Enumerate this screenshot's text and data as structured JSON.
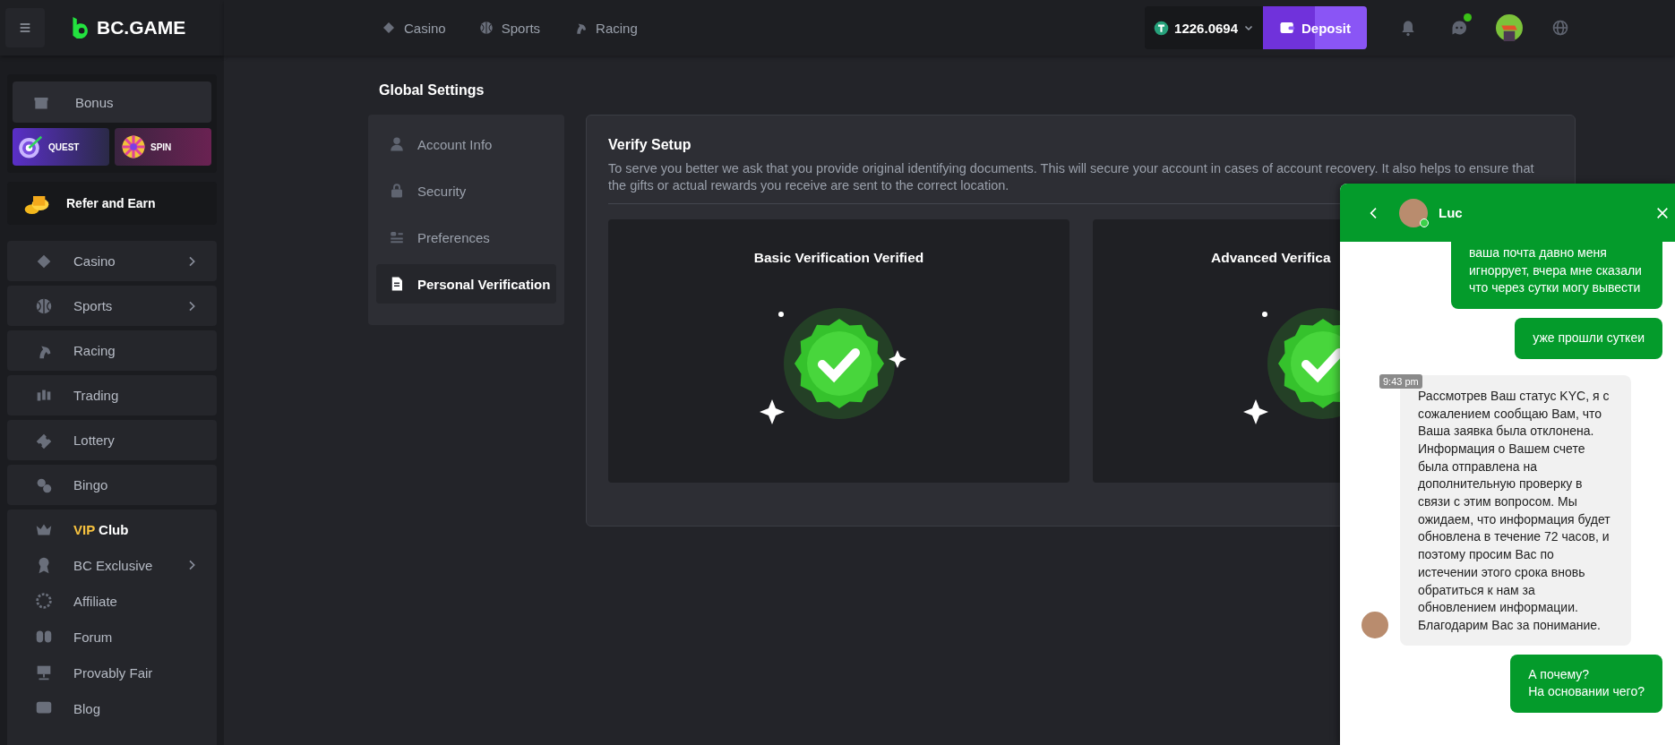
{
  "logo": {
    "text": "BC.GAME"
  },
  "sidebar": {
    "bonus": {
      "label": "Bonus"
    },
    "promos": [
      {
        "label": "QUEST",
        "kind": "quest"
      },
      {
        "label": "SPIN",
        "kind": "spin"
      }
    ],
    "refer": {
      "label": "Refer and Earn"
    },
    "items": [
      {
        "label": "Casino",
        "has_submenu": true
      },
      {
        "label": "Sports",
        "has_submenu": true
      },
      {
        "label": "Racing",
        "has_submenu": false
      },
      {
        "label": "Trading",
        "has_submenu": false
      },
      {
        "label": "Lottery",
        "has_submenu": false
      },
      {
        "label": "Bingo",
        "has_submenu": false
      }
    ],
    "group": [
      {
        "accent": "VIP",
        "label": "Club",
        "has_submenu": false
      },
      {
        "label": "BC Exclusive",
        "has_submenu": true
      },
      {
        "label": "Affiliate",
        "has_submenu": false
      },
      {
        "label": "Forum",
        "has_submenu": false
      },
      {
        "label": "Provably Fair",
        "has_submenu": false
      },
      {
        "label": "Blog",
        "has_submenu": false
      }
    ]
  },
  "top_nav": [
    {
      "label": "Casino"
    },
    {
      "label": "Sports"
    },
    {
      "label": "Racing"
    }
  ],
  "wallet": {
    "balance": "1226.0694",
    "deposit": "Deposit"
  },
  "chat_unread": true,
  "settings": {
    "title": "Global Settings",
    "menu": [
      {
        "label": "Account Info",
        "selected": false
      },
      {
        "label": "Security",
        "selected": false
      },
      {
        "label": "Preferences",
        "selected": false
      },
      {
        "label": "Personal Verification",
        "selected": true
      }
    ],
    "panel": {
      "title": "Verify Setup",
      "description": "To serve you better we ask that you provide original identifying documents. This will secure your account in cases of account recovery. It also helps to ensure that the gifts or actual rewards you receive are sent to the correct location.",
      "cards": [
        {
          "title": "Basic Verification Verified",
          "verified": true
        },
        {
          "title": "Advanced Verifica",
          "verified": true
        }
      ]
    }
  },
  "chat": {
    "agent": "Luc",
    "agent_online": true,
    "messages": [
      {
        "kind": "user",
        "text": "ваша почта давно меня игнорруeт, вчера мне сказали что через сутки могу вывести"
      },
      {
        "kind": "user",
        "text": "уже прошли суткеи"
      },
      {
        "kind": "agent",
        "time": "9:43 pm",
        "text": "Рассмотрев Ваш статус KYC, я с сожалением сообщаю Вам, что Ваша заявка была отклонена. Информация о Вашем счете была отправлена на дополнительную проверку в связи с этим вопросом. Мы ожидаем, что информация будет обновлена в течение 72 часов, и поэтому просим Вас по истечении этого срока вновь обратиться к нам за обновлением информации. Благодарим Вас за понимание."
      },
      {
        "kind": "user",
        "text": "А почему?\nНа основании чего?"
      }
    ]
  }
}
